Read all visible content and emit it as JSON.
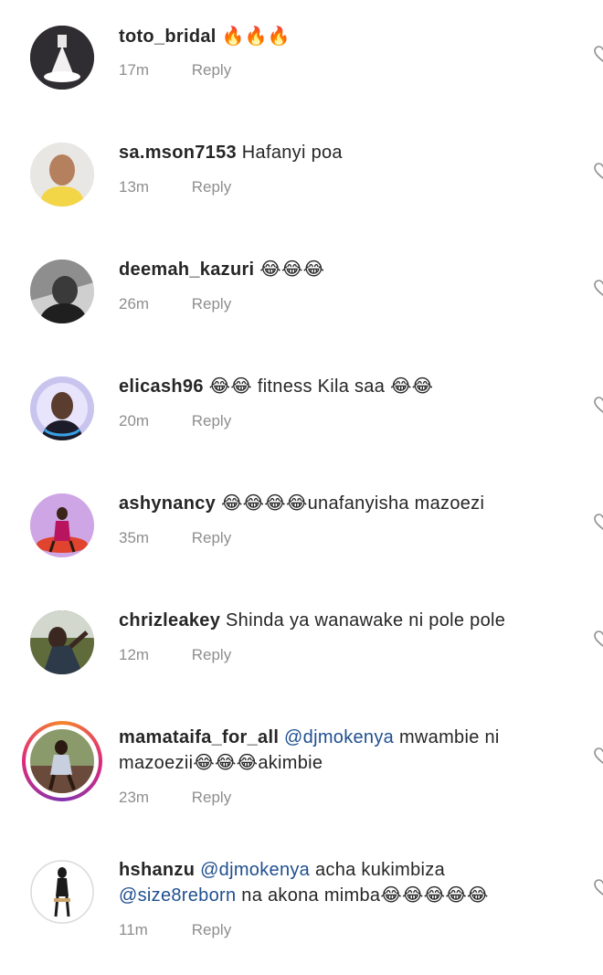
{
  "comments": [
    {
      "username": "toto_bridal",
      "text": "🔥🔥🔥",
      "time": "17m",
      "reply": "Reply"
    },
    {
      "username": "sa.mson7153",
      "text": "Hafanyi poa",
      "time": "13m",
      "reply": "Reply"
    },
    {
      "username": "deemah_kazuri",
      "text": "😂😂😂",
      "time": "26m",
      "reply": "Reply"
    },
    {
      "username": "elicash96",
      "text": "😂😂 fitness Kila saa 😂😂",
      "time": "20m",
      "reply": "Reply"
    },
    {
      "username": "ashynancy",
      "text": "😂😂😂😂unafanyisha mazoezi",
      "time": "35m",
      "reply": "Reply"
    },
    {
      "username": "chrizleakey",
      "text": "Shinda ya wanawake ni pole pole",
      "time": "12m",
      "reply": "Reply"
    },
    {
      "username": "mamataifa_for_all",
      "mention": "@djmokenya",
      "text": "mwambie ni mazoezii😂😂😂akimbie",
      "time": "23m",
      "reply": "Reply"
    },
    {
      "username": "hshanzu",
      "mention": "@djmokenya",
      "text": "acha kukimbiza",
      "mention2": "@size8reborn",
      "text2": "na akona mimba😂😂😂😂😂",
      "time": "11m",
      "reply": "Reply"
    }
  ],
  "icons": {
    "like": "heart-outline-icon"
  },
  "colors": {
    "mention": "#1f4f8f",
    "meta": "#8e8e8e",
    "text": "#262626"
  }
}
